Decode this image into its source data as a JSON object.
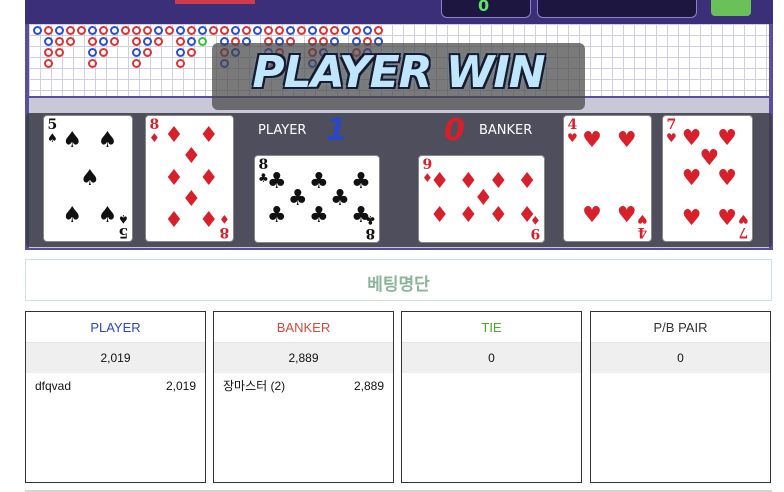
{
  "banner": {
    "text": "PLAYER WIN"
  },
  "round": {
    "player_label": "PLAYER",
    "player_score": "1",
    "banker_label": "BANKER",
    "banker_score": "0",
    "player_cards": [
      {
        "rank": "5",
        "suit": "♠",
        "color": "#111111"
      },
      {
        "rank": "8",
        "suit": "♦",
        "color": "#d8202a"
      },
      {
        "rank": "8",
        "suit": "♣",
        "color": "#111111"
      }
    ],
    "banker_cards": [
      {
        "rank": "9",
        "suit": "♦",
        "color": "#d8202a"
      },
      {
        "rank": "4",
        "suit": "♥",
        "color": "#d8202a"
      },
      {
        "rank": "7",
        "suit": "♥",
        "color": "#d8202a"
      }
    ]
  },
  "topbar": {
    "counter": "0",
    "speaker_icon": "speaker-icon"
  },
  "betting": {
    "title": "베팅명단",
    "columns": [
      {
        "label": "PLAYER",
        "color": "#2b47c9",
        "total": "2,019",
        "bets": [
          {
            "name": "dfqvad",
            "amount": "2,019"
          }
        ]
      },
      {
        "label": "BANKER",
        "color": "#d24a3a",
        "total": "2,889",
        "bets": [
          {
            "name": "장마스터 (2)",
            "amount": "2,889"
          }
        ]
      },
      {
        "label": "TIE",
        "color": "#4aa82a",
        "total": "0",
        "bets": []
      },
      {
        "label": "P/B PAIR",
        "color": "#333333",
        "total": "0",
        "bets": []
      }
    ]
  },
  "colors": {
    "game_bg": "#5a4f9c",
    "player": "#2b47c9",
    "banker": "#d8202a",
    "tie": "#3bbf3b"
  }
}
